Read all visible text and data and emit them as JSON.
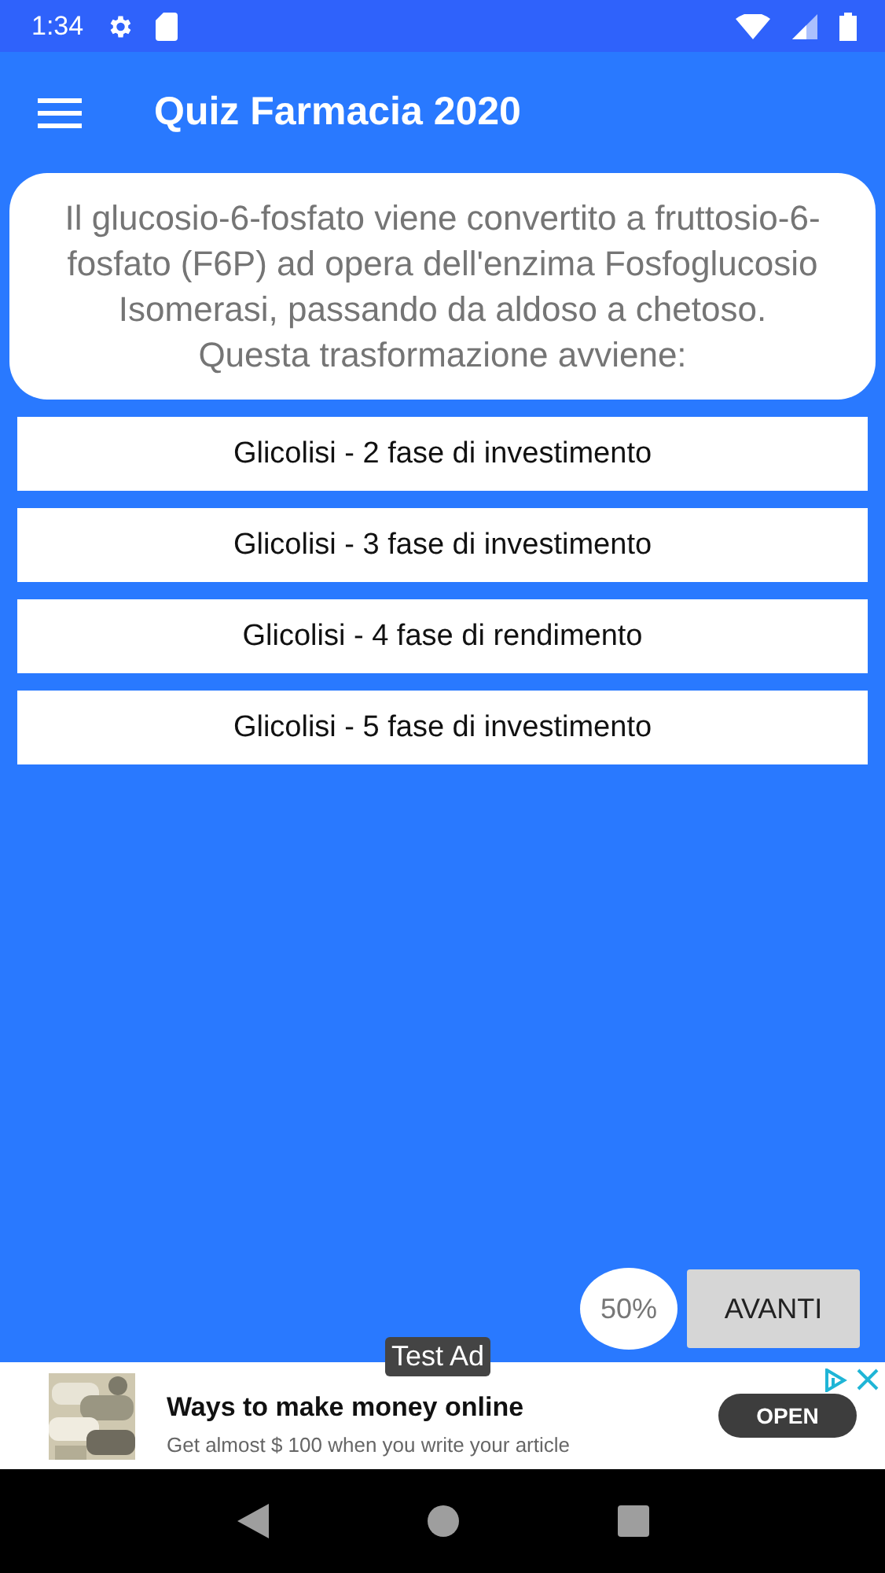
{
  "status_bar": {
    "time": "1:34"
  },
  "app_bar": {
    "title": "Quiz Farmacia 2020"
  },
  "question": "Il glucosio-6-fosfato viene convertito a fruttosio-6-fosfato (F6P) ad opera dell'enzima Fosfoglucosio Isomerasi, passando da aldoso a chetoso. Questa trasformazione avviene:",
  "answers": [
    {
      "label": "Glicolisi - 2 fase di investimento"
    },
    {
      "label": "Glicolisi - 3 fase di investimento"
    },
    {
      "label": "Glicolisi - 4 fase di rendimento"
    },
    {
      "label": "Glicolisi - 5 fase di investimento"
    }
  ],
  "progress": "50%",
  "next_button": "AVANTI",
  "ad": {
    "badge": "Test Ad",
    "title": "Ways to make money online",
    "text": "Get almost $ 100 when you write your article",
    "button": "OPEN"
  }
}
